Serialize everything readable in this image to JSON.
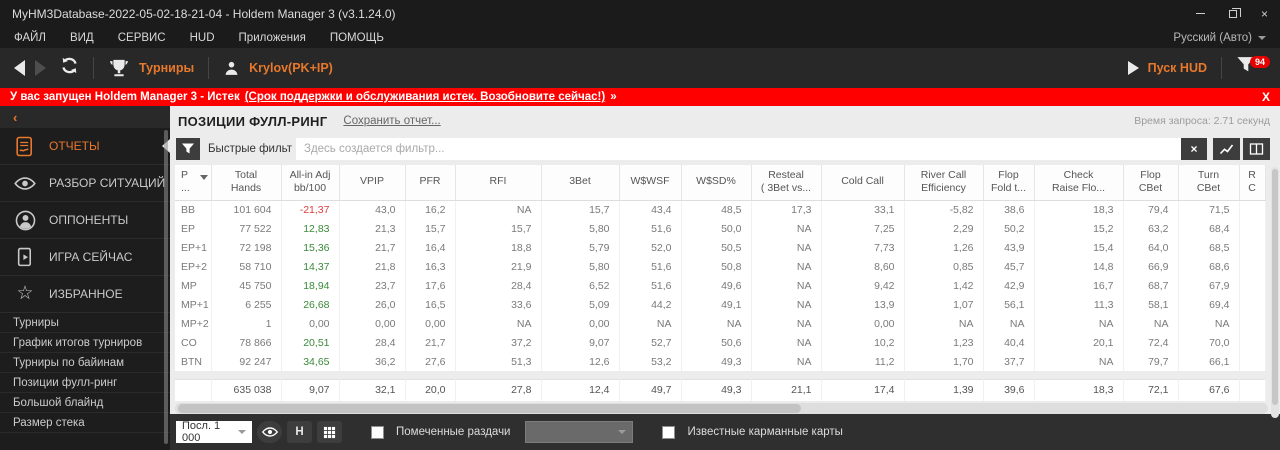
{
  "window": {
    "title": "MyHM3Database-2022-05-02-18-21-04 - Holdem Manager 3 (v3.1.24.0)",
    "close_glyph": "×"
  },
  "menu": {
    "items": [
      {
        "label": "ФАЙЛ"
      },
      {
        "label": "ВИД"
      },
      {
        "label": "СЕРВИС"
      },
      {
        "label": "HUD"
      },
      {
        "label": "Приложения"
      },
      {
        "label": "ПОМОЩЬ"
      }
    ],
    "language": "Русский (Авто)"
  },
  "toolbar": {
    "tournaments_label": "Турниры",
    "player_label": "Krylov(PK+IP)",
    "hud_label": "Пуск HUD",
    "filter_badge": "94"
  },
  "banner": {
    "prefix": "У вас запущен Holdem Manager 3 - Истек",
    "link": "(Срок поддержки и обслуживания истек. Возобновите сейчас!)",
    "chevrons": "»",
    "close": "X"
  },
  "sidebar": {
    "collapse_glyph": "‹",
    "sections": [
      {
        "label": "ОТЧЕТЫ",
        "active": true
      },
      {
        "label": "РАЗБОР СИТУАЦИЙ"
      },
      {
        "label": "ОППОНЕНТЫ"
      },
      {
        "label": "ИГРА СЕЙЧАС"
      },
      {
        "label": "ИЗБРАННОЕ"
      }
    ],
    "star_glyph": "☆",
    "reports": [
      {
        "label": "Турниры"
      },
      {
        "label": "График итогов турниров"
      },
      {
        "label": "Турниры по байинам"
      },
      {
        "label": "Позиции фулл-ринг"
      },
      {
        "label": "Большой блайнд"
      },
      {
        "label": "Размер стека"
      }
    ]
  },
  "report": {
    "title": "ПОЗИЦИИ ФУЛЛ-РИНГ",
    "save_link": "Сохранить отчет...",
    "query_time": "Время запроса: 2.71 секунд",
    "quick_filter_label": "Быстрые фильтр",
    "filter_placeholder": "Здесь создается фильтр...",
    "clear_glyph": "×"
  },
  "table": {
    "columns": [
      {
        "label": "P\n..."
      },
      {
        "label": "Total\nHands"
      },
      {
        "label": "All-in Adj\nbb/100"
      },
      {
        "label": "VPIP"
      },
      {
        "label": "PFR"
      },
      {
        "label": "RFI"
      },
      {
        "label": "3Bet"
      },
      {
        "label": "W$WSF"
      },
      {
        "label": "W$SD%"
      },
      {
        "label": "Resteal\n( 3Bet vs..."
      },
      {
        "label": "Cold Call"
      },
      {
        "label": "River Call\nEfficiency"
      },
      {
        "label": "Flop\nFold t..."
      },
      {
        "label": "Check\nRaise Flo..."
      },
      {
        "label": "Flop\nCBet"
      },
      {
        "label": "Turn\nCBet"
      },
      {
        "label": "R\nC"
      }
    ],
    "rows": [
      {
        "allin": "neg",
        "cells": [
          "BB",
          "101 604",
          "-21,37",
          "43,0",
          "16,2",
          "NA",
          "15,7",
          "43,4",
          "48,5",
          "17,3",
          "33,1",
          "-5,82",
          "38,6",
          "18,3",
          "79,4",
          "71,5",
          ""
        ]
      },
      {
        "allin": "gain",
        "cells": [
          "EP",
          "77 522",
          "12,83",
          "21,3",
          "15,7",
          "15,7",
          "5,80",
          "51,6",
          "50,0",
          "NA",
          "7,25",
          "2,29",
          "50,2",
          "15,2",
          "63,2",
          "68,4",
          ""
        ]
      },
      {
        "allin": "gain",
        "cells": [
          "EP+1",
          "72 198",
          "15,36",
          "21,7",
          "16,4",
          "18,8",
          "5,79",
          "52,0",
          "50,5",
          "NA",
          "7,73",
          "1,26",
          "43,9",
          "15,4",
          "64,0",
          "68,5",
          ""
        ]
      },
      {
        "allin": "gain",
        "cells": [
          "EP+2",
          "58 710",
          "14,37",
          "21,8",
          "16,3",
          "21,9",
          "5,80",
          "51,6",
          "50,8",
          "NA",
          "8,60",
          "0,85",
          "45,7",
          "14,8",
          "66,9",
          "68,6",
          ""
        ]
      },
      {
        "allin": "gain",
        "cells": [
          "MP",
          "45 750",
          "18,94",
          "23,7",
          "17,6",
          "28,4",
          "6,52",
          "51,6",
          "49,6",
          "NA",
          "9,42",
          "1,42",
          "42,9",
          "16,7",
          "68,7",
          "67,9",
          ""
        ]
      },
      {
        "allin": "gain",
        "cells": [
          "MP+1",
          "6 255",
          "26,68",
          "26,0",
          "16,5",
          "33,6",
          "5,09",
          "44,2",
          "49,1",
          "NA",
          "13,9",
          "1,07",
          "56,1",
          "11,3",
          "58,1",
          "69,4",
          ""
        ]
      },
      {
        "allin": "zero",
        "cells": [
          "MP+2",
          "1",
          "0,00",
          "0,00",
          "0,00",
          "NA",
          "0,00",
          "NA",
          "NA",
          "NA",
          "0,00",
          "NA",
          "NA",
          "NA",
          "NA",
          "NA",
          ""
        ]
      },
      {
        "allin": "gain",
        "cells": [
          "CO",
          "78 866",
          "20,51",
          "28,4",
          "21,7",
          "37,2",
          "9,07",
          "52,7",
          "50,6",
          "NA",
          "10,2",
          "1,23",
          "40,4",
          "20,1",
          "72,4",
          "70,0",
          ""
        ]
      },
      {
        "allin": "gain",
        "cells": [
          "BTN",
          "92 247",
          "34,65",
          "36,2",
          "27,6",
          "51,3",
          "12,6",
          "53,2",
          "49,3",
          "NA",
          "11,2",
          "1,70",
          "37,7",
          "NA",
          "79,7",
          "66,1",
          ""
        ]
      }
    ],
    "summary": {
      "cells": [
        "",
        "635 038",
        "9,07",
        "32,1",
        "20,0",
        "27,8",
        "12,4",
        "49,7",
        "49,3",
        "21,1",
        "17,4",
        "1,39",
        "39,6",
        "18,3",
        "72,1",
        "67,6",
        ""
      ]
    }
  },
  "footer": {
    "last_hands": "Посл. 1 000",
    "h_label": "H",
    "marked_hands_label": "Помеченные раздачи",
    "known_cards_label": "Известные карманные карты"
  }
}
